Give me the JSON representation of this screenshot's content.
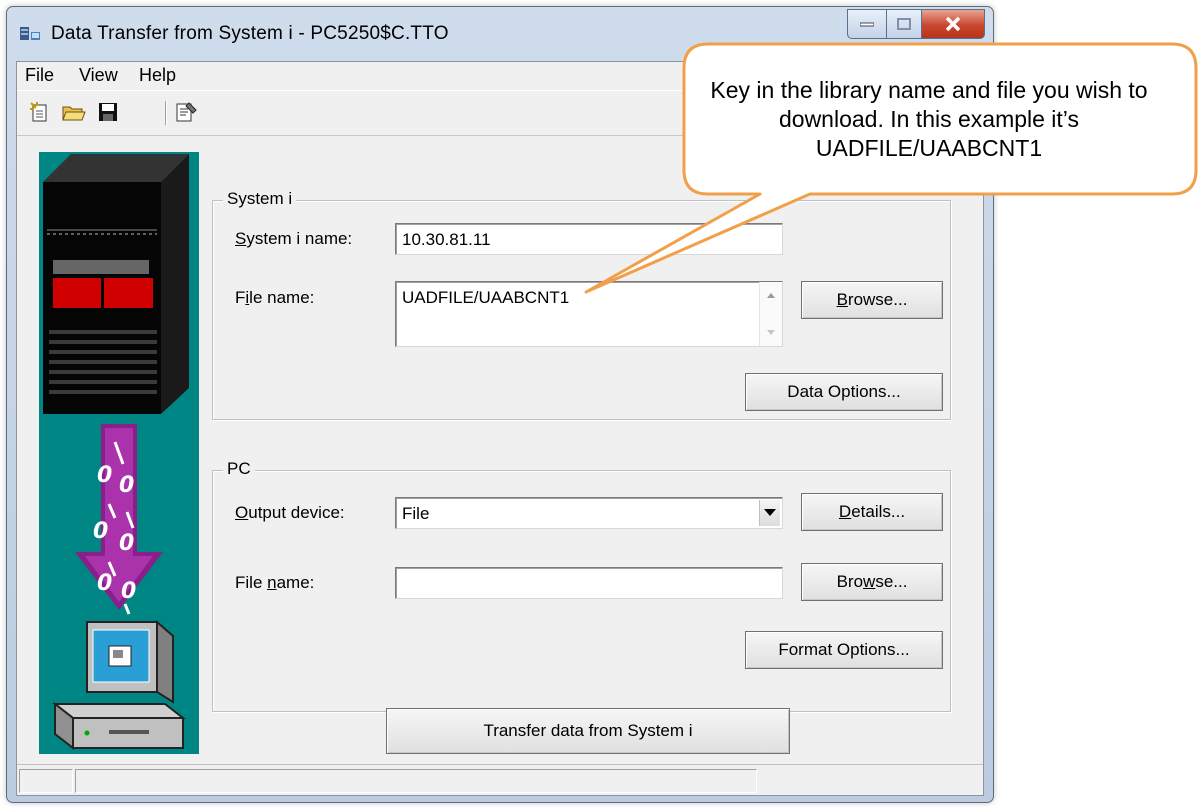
{
  "window": {
    "title": "Data Transfer from System i - PC5250$C.TTO"
  },
  "menu": [
    "File",
    "View",
    "Help"
  ],
  "toolbar": {
    "icons": [
      "new-icon",
      "open-folder-icon",
      "save-icon",
      "properties-icon"
    ]
  },
  "system_i": {
    "group_label": "System i",
    "system_name_label": "System i name:",
    "system_name_value": "10.30.81.11",
    "file_name_label": "File name:",
    "file_name_value": "UADFILE/UAABCNT1",
    "browse_label": "Browse...",
    "data_options_label": "Data Options..."
  },
  "pc": {
    "group_label": "PC",
    "output_device_label": "Output device:",
    "output_device_value": "File",
    "details_label": "Details...",
    "file_name_label": "File name:",
    "file_name_value": "",
    "browse_label": "Browse...",
    "format_options_label": "Format Options..."
  },
  "transfer_button": "Transfer data from System i",
  "callout": {
    "text": "Key in the library name and file you wish to download.  In this example it’s UADFILE/UAABCNT1"
  },
  "colors": {
    "art_background": "#008585",
    "callout_border": "#f0a04a",
    "title_close": "#c8462e"
  }
}
